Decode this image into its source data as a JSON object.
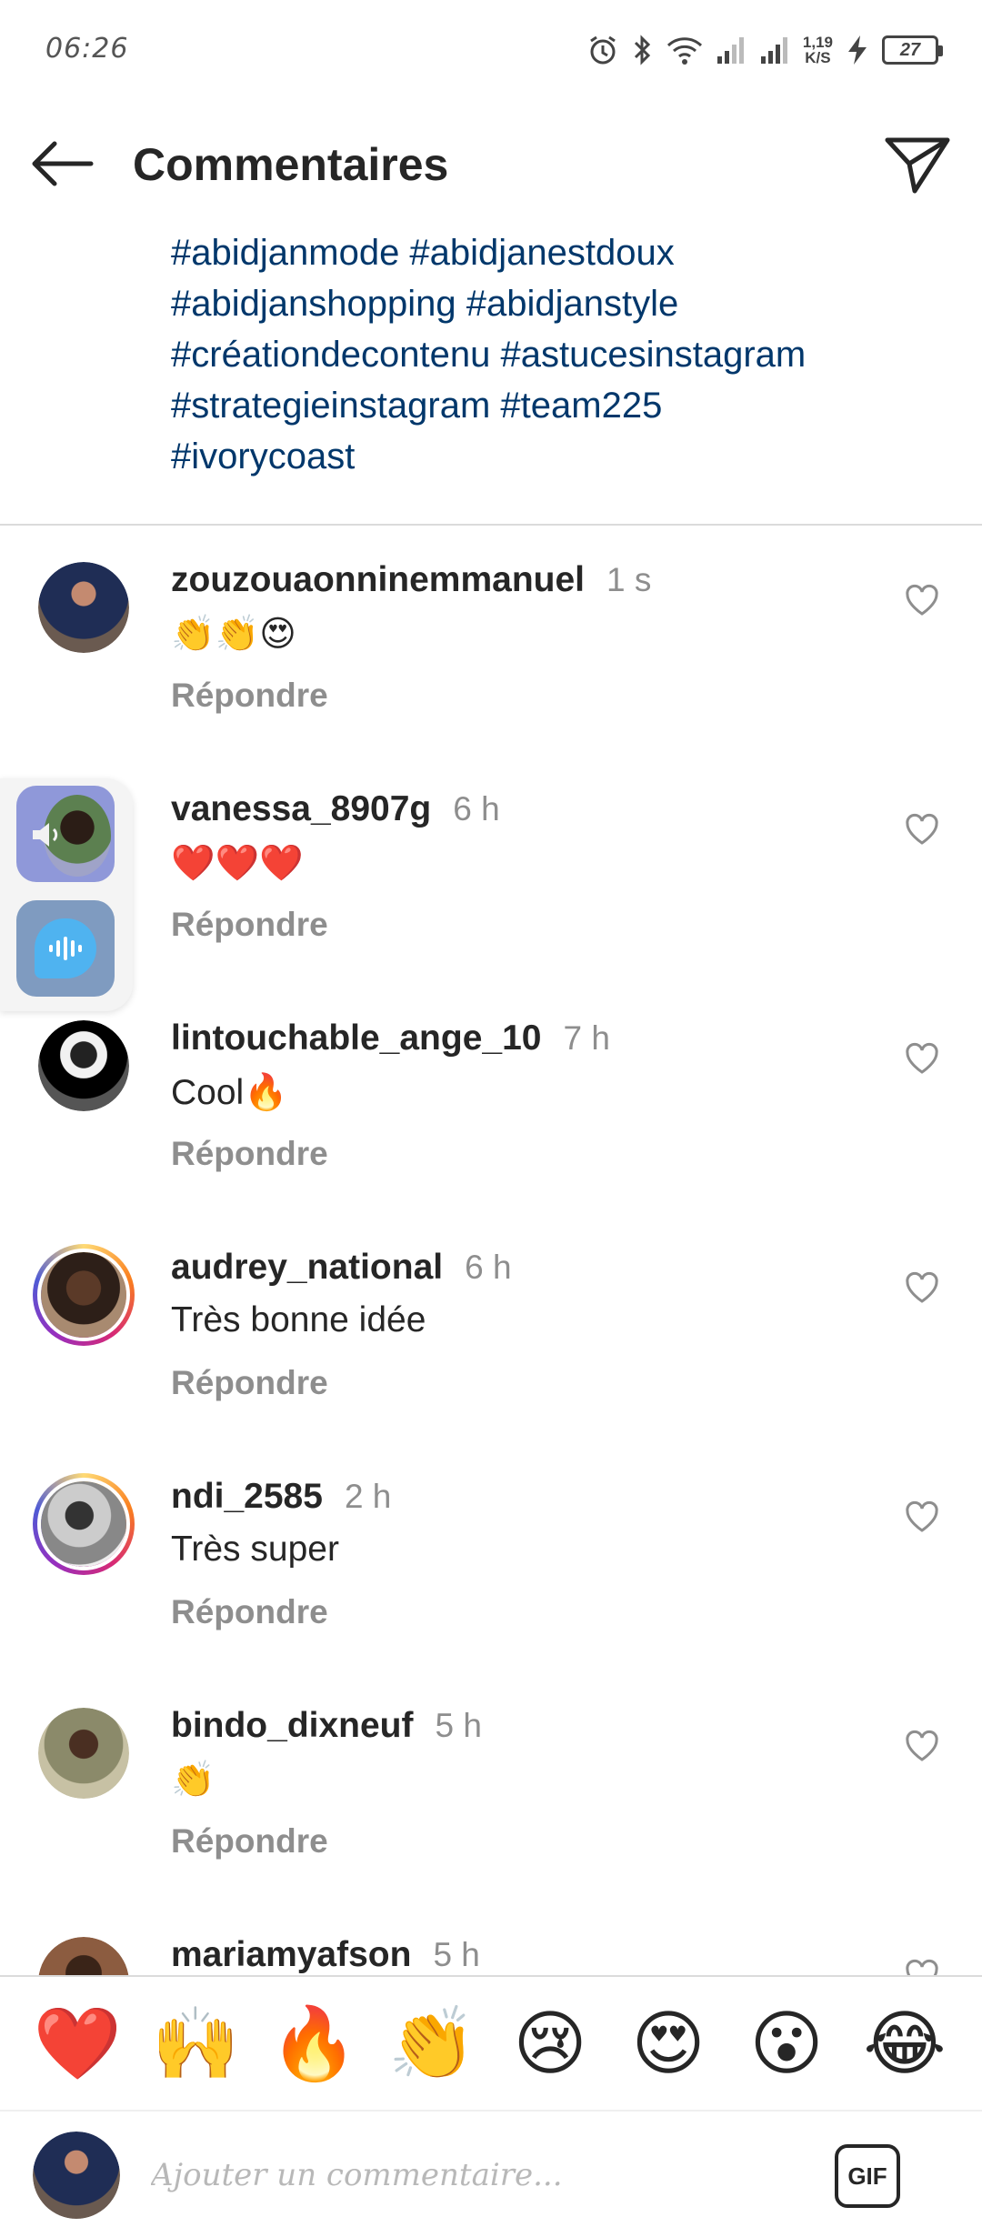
{
  "status_bar": {
    "time": "06:26",
    "net_speed_value": "1,19",
    "net_speed_unit": "K/S",
    "battery_level": "27"
  },
  "header": {
    "title": "Commentaires"
  },
  "caption": {
    "hashtag_lines": [
      "#abidjanmode #abidjanestdoux",
      "#abidjanshopping #abidjanstyle",
      "#créationdecontenu #astucesinstagram",
      "#strategieinstagram #team225",
      "#ivorycoast"
    ]
  },
  "comments": [
    {
      "username": "zouzouaonninemmanuel",
      "time": "1 s",
      "text": "👏👏😍",
      "reply_label": "Répondre"
    },
    {
      "username": "vanessa_8907g",
      "time": "6 h",
      "text": "❤️❤️❤️",
      "reply_label": "Répondre"
    },
    {
      "username": "lintouchable_ange_10",
      "time": "7 h",
      "text": "Cool🔥",
      "reply_label": "Répondre"
    },
    {
      "username": "audrey_national",
      "time": "6 h",
      "text": "Très bonne idée",
      "reply_label": "Répondre"
    },
    {
      "username": "ndi_2585",
      "time": "2 h",
      "text": "Très super",
      "reply_label": "Répondre"
    },
    {
      "username": "bindo_dixneuf",
      "time": "5 h",
      "text": "👏",
      "reply_label": "Répondre"
    },
    {
      "username": "mariamyafson",
      "time": "5 h",
      "text": "",
      "reply_label": ""
    }
  ],
  "emoji_bar": [
    "❤️",
    "🙌",
    "🔥",
    "👏",
    "😢",
    "😍",
    "😮",
    "😂"
  ],
  "composer": {
    "placeholder": "Ajouter un commentaire...",
    "gif_label": "GIF"
  },
  "colors": {
    "hashtag": "#00376b",
    "muted": "#8e8e8e",
    "text": "#262626",
    "divider": "#dbdbdb"
  }
}
